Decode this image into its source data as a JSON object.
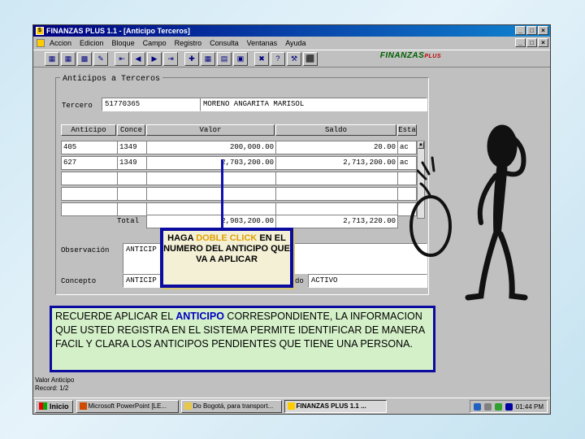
{
  "window": {
    "title": "FINANZAS PLUS 1.1 - [Anticipo Terceros]",
    "btn_min": "_",
    "btn_max": "□",
    "btn_close": "×"
  },
  "menu": [
    "Accion",
    "Edicion",
    "Bloque",
    "Campo",
    "Registro",
    "Consulta",
    "Ventanas",
    "Ayuda"
  ],
  "toolbar_icons": [
    "save-icon",
    "print-icon",
    "calc-icon",
    "edit-icon",
    "first-icon",
    "prev-icon",
    "next-icon",
    "last-icon",
    "insert-icon",
    "delete-icon",
    "lock-icon",
    "list-icon",
    "exit-icon",
    "help-icon",
    "tools-icon",
    "door-icon"
  ],
  "toolbar_glyphs": [
    "▦",
    "▦",
    "▩",
    "✎",
    "⇤",
    "◀",
    "▶",
    "⇥",
    "✚",
    "▦",
    "▤",
    "▣",
    "✖",
    "?",
    "⚒",
    "⬛"
  ],
  "logo": {
    "text": "FINANZAS",
    "sub": "PLUS"
  },
  "form": {
    "section_title": "Anticipos a Terceros",
    "tercero_label": "Tercero",
    "tercero_id": "51770365",
    "tercero_name": "MORENO ANGARITA MARISOL",
    "columns": [
      "Anticipo",
      "Conce",
      "Valor",
      "Saldo",
      "Esta"
    ],
    "rows": [
      [
        "405",
        "1349",
        "200,000.00",
        "20.00",
        "ac"
      ],
      [
        "627",
        "1349",
        "2,703,200.00",
        "2,713,200.00",
        "ac"
      ],
      [
        "",
        "",
        "",
        "",
        ""
      ],
      [
        "",
        "",
        "",
        "",
        ""
      ],
      [
        "",
        "",
        "",
        "",
        ""
      ]
    ],
    "total_label": "Total",
    "total_valor": "2,903,200.00",
    "total_saldo": "2,713,220.00",
    "observacion_label": "Observación",
    "observacion_value": "ANTICIP",
    "concepto_label": "Concepto",
    "concepto_value": "ANTICIP",
    "estado_label_tail": "do",
    "estado_value": "ACTIVO"
  },
  "status": {
    "line1": "Valor Anticipo",
    "line2": "Record: 1/2"
  },
  "taskbar": {
    "start": "Inicio",
    "items": [
      "Microsoft PowerPoint [LE...",
      "Do Bogotá, para transport...",
      "FINANZAS PLUS 1.1 ..."
    ],
    "clock": "01:44 PM"
  },
  "callout": {
    "pre": "HAGA ",
    "highlight": "DOBLE CLICK",
    "post": " EN EL NUMERO DEL ANTICIPO QUE VA A APLICAR"
  },
  "note": {
    "pre": "RECUERDE APLICAR EL ",
    "highlight": "ANTICIPO",
    "post": " CORRESPONDIENTE, LA INFORMACION QUE USTED REGISTRA EN EL SISTEMA PERMITE IDENTIFICAR DE MANERA FACIL Y CLARA LOS ANTICIPOS PENDIENTES QUE TIENE UNA PERSONA."
  },
  "colors": {
    "accent_border": "#0b0ba0",
    "note_bg": "#d4f0c8",
    "callout_bg": "#f4f0d6",
    "callout_highlight": "#e0a000"
  }
}
